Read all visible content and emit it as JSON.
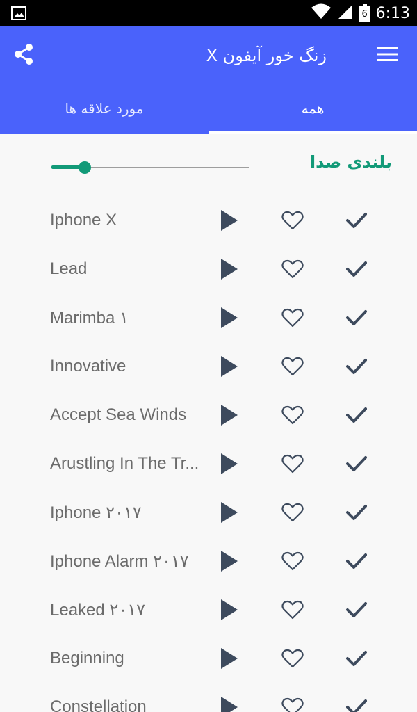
{
  "status_bar": {
    "time": "6:13",
    "battery_level": "6",
    "icons": [
      "image-notification-icon",
      "wifi-icon",
      "signal-icon",
      "battery-icon"
    ]
  },
  "header": {
    "title": "زنگ خور آیفون X",
    "share_icon": "share-icon",
    "menu_icon": "hamburger-menu-icon"
  },
  "tabs": [
    {
      "label": "مورد علاقه ها",
      "active": false
    },
    {
      "label": "همه",
      "active": true
    }
  ],
  "volume": {
    "label": "بلندی صدا",
    "level": 0.17
  },
  "ringtones": [
    {
      "name": "Iphone X"
    },
    {
      "name": "Lead"
    },
    {
      "name": "Marimba ۱"
    },
    {
      "name": "Innovative"
    },
    {
      "name": "Accept Sea Winds"
    },
    {
      "name": "Arustling In The Tr..."
    },
    {
      "name": "Iphone ۲۰۱۷"
    },
    {
      "name": "Iphone Alarm ۲۰۱۷"
    },
    {
      "name": "Leaked ۲۰۱۷"
    },
    {
      "name": "Beginning"
    },
    {
      "name": "Constellation"
    }
  ],
  "colors": {
    "accent": "#4a62fb",
    "volume_green": "#129a78",
    "icon_dark": "#3d4a5d",
    "text_gray": "#6b6b6b"
  }
}
